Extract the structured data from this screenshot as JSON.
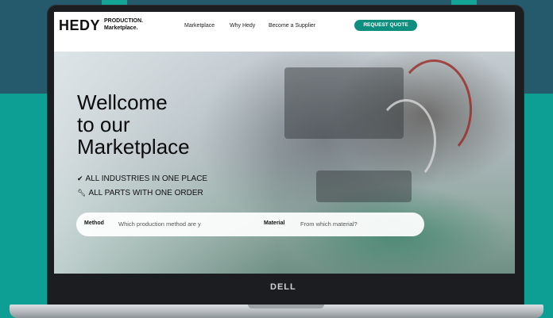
{
  "nav": {
    "logo": "HEDY",
    "logo_tag_line1": "PRODUCTION.",
    "logo_tag_line2": "Marketplace.",
    "links": [
      "Marketplace",
      "Why Hedy",
      "Become a Supplier"
    ],
    "cta": "REQUEST QUOTE"
  },
  "hero": {
    "title_lines": [
      "Wellcome",
      "to our",
      "Marketplace"
    ],
    "features": [
      {
        "icon": "check-icon",
        "text": "ALL INDUSTRIES IN ONE PLACE"
      },
      {
        "icon": "wrench-icon",
        "text": "ALL PARTS WITH ONE ORDER"
      }
    ]
  },
  "search": {
    "method_label": "Method",
    "method_placeholder": "Which production method are y",
    "material_label": "Material",
    "material_placeholder": "From which material?"
  },
  "device": {
    "brand": "DELL"
  },
  "colors": {
    "teal_bg": "#0d9f93",
    "navy_bg": "#255a6c",
    "cta": "#0e8e7f"
  }
}
